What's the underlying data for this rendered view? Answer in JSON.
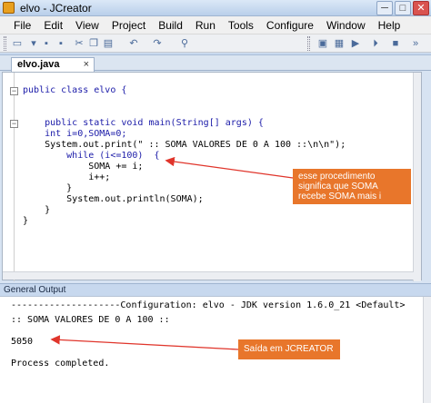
{
  "window": {
    "title": "elvo - JCreator",
    "controls": [
      "─",
      "□",
      "✕"
    ]
  },
  "menu": [
    "File",
    "Edit",
    "View",
    "Project",
    "Build",
    "Run",
    "Tools",
    "Configure",
    "Window",
    "Help"
  ],
  "toolbar": {
    "icons": [
      "new-file-icon",
      "open-icon",
      "save-icon",
      "save-all-icon",
      "cut-icon",
      "copy-icon",
      "paste-icon",
      "undo-icon",
      "redo-icon",
      "find-icon",
      "compile-icon",
      "run-icon",
      "debug-icon",
      "stop-icon",
      "more-icon"
    ]
  },
  "editor": {
    "tab_label": "elvo.java",
    "tab_close": "×",
    "lines": [
      "public class elvo {",
      "    public static void main(String[] args) {",
      "    int i=0,SOMA=0;",
      "    System.out.print(\" :: SOMA VALORES DE 0 A 100 ::\\n\\n\");",
      "        while (i<=100)  {",
      "            SOMA += i;",
      "            i++;",
      "        }",
      "        System.out.println(SOMA);",
      "    }",
      "}"
    ]
  },
  "output": {
    "title": "General Output",
    "lines": [
      "--------------------Configuration: elvo - JDK version 1.6.0_21 <Default>",
      ":: SOMA VALORES DE 0 A 100 ::",
      "",
      "5050",
      "",
      "Process completed."
    ]
  },
  "annotations": {
    "callout_code": "esse procedimento significa que SOMA recebe SOMA mais i",
    "callout_output": "Saída em JCREATOR",
    "color": "#e8762b"
  }
}
